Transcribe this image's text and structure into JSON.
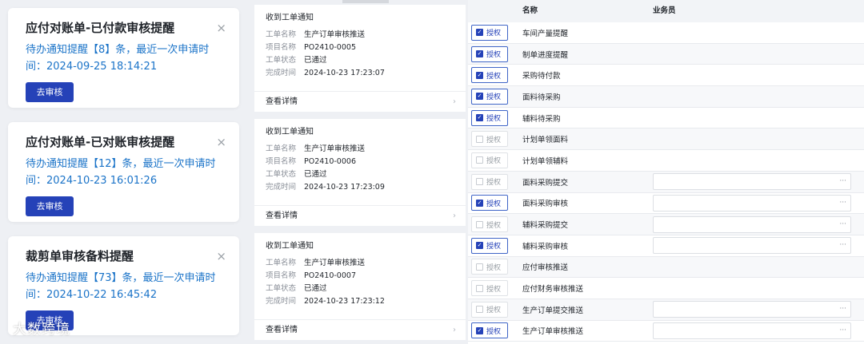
{
  "reminders": [
    {
      "title": "应付对账单-已付款审核提醒",
      "msg_prefix": "待办通知提醒【8】条，最近一次申请时间：",
      "time": "2024-09-25 18:14:21",
      "button": "去审核"
    },
    {
      "title": "应付对账单-已对账审核提醒",
      "msg_prefix": "待办通知提醒【12】条，最近一次申请时间：",
      "time": "2024-10-23 16:01:26",
      "button": "去审核"
    },
    {
      "title": "裁剪单审核备料提醒",
      "msg_prefix": "待办通知提醒【73】条，最近一次申请时间：",
      "time": "2024-10-22 16:45:42",
      "button": "去审核"
    }
  ],
  "close_glyph": "×",
  "notices": [
    {
      "title": "收到工单通知",
      "rows": [
        [
          "工单名称",
          "生产订单审核推送"
        ],
        [
          "项目名称",
          "PO2410-0005"
        ],
        [
          "工单状态",
          "已通过"
        ],
        [
          "完成时间",
          "2024-10-23 17:23:07"
        ]
      ],
      "footer": "查看详情"
    },
    {
      "title": "收到工单通知",
      "rows": [
        [
          "工单名称",
          "生产订单审核推送"
        ],
        [
          "项目名称",
          "PO2410-0006"
        ],
        [
          "工单状态",
          "已通过"
        ],
        [
          "完成时间",
          "2024-10-23 17:23:09"
        ]
      ],
      "footer": "查看详情"
    },
    {
      "title": "收到工单通知",
      "rows": [
        [
          "工单名称",
          "生产订单审核推送"
        ],
        [
          "项目名称",
          "PO2410-0007"
        ],
        [
          "工单状态",
          "已通过"
        ],
        [
          "完成时间",
          "2024-10-23 17:23:12"
        ]
      ],
      "footer": "查看详情"
    }
  ],
  "arrow_glyph": "›",
  "table": {
    "headers": [
      "",
      "名称",
      "业务员"
    ],
    "auth_label": "授权",
    "rows": [
      {
        "name": "车间产量提醒",
        "checked": true,
        "has_select": false
      },
      {
        "name": "制单进度提醒",
        "checked": true,
        "has_select": false
      },
      {
        "name": "采购待付款",
        "checked": true,
        "has_select": false
      },
      {
        "name": "面料待采购",
        "checked": true,
        "has_select": false
      },
      {
        "name": "辅料待采购",
        "checked": true,
        "has_select": false
      },
      {
        "name": "计划单领面料",
        "checked": false,
        "has_select": false
      },
      {
        "name": "计划单领辅料",
        "checked": false,
        "has_select": false
      },
      {
        "name": "面料采购提交",
        "checked": false,
        "has_select": true
      },
      {
        "name": "面料采购审核",
        "checked": true,
        "has_select": true
      },
      {
        "name": "辅料采购提交",
        "checked": false,
        "has_select": true
      },
      {
        "name": "辅料采购审核",
        "checked": true,
        "has_select": true
      },
      {
        "name": "应付审核推送",
        "checked": false,
        "has_select": false
      },
      {
        "name": "应付财务审核推送",
        "checked": false,
        "has_select": false
      },
      {
        "name": "生产订单提交推送",
        "checked": false,
        "has_select": true
      },
      {
        "name": "生产订单审核推送",
        "checked": true,
        "has_select": true
      }
    ],
    "select_dots": "···"
  },
  "watermark": "大数跨境",
  "colors": {
    "accent": "#2542b8",
    "link": "#1a73c8"
  }
}
